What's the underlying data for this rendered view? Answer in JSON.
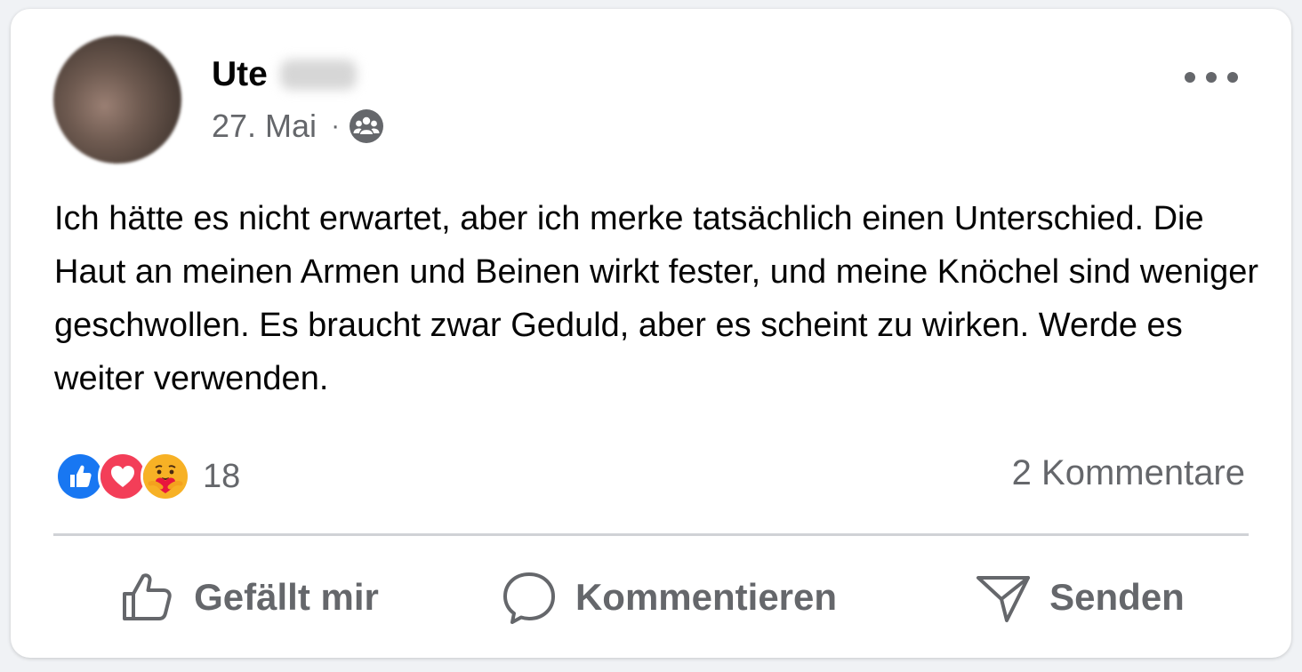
{
  "post": {
    "author": {
      "name": "Ute"
    },
    "date": "27. Mai",
    "separator": "·",
    "audience_icon": "group-icon",
    "text": "Ich hätte es nicht erwartet, aber ich merke tatsächlich einen Unterschied. Die Haut an meinen Armen und Beinen wirkt fester, und meine Knöchel sind weniger geschwollen. Es braucht zwar Geduld, aber es scheint zu wirken. Werde es weiter verwenden.",
    "reactions": {
      "types": [
        "like-icon",
        "love-icon",
        "care-icon"
      ],
      "count": "18"
    },
    "comments_label": "2 Kommentare"
  },
  "actions": {
    "like_label": "Gefällt mir",
    "comment_label": "Kommentieren",
    "send_label": "Senden"
  },
  "colors": {
    "like_blue": "#1877f2",
    "love_red": "#f33e58",
    "care_yellow": "#f7b125",
    "muted_text": "#65676b",
    "text": "#050505"
  }
}
